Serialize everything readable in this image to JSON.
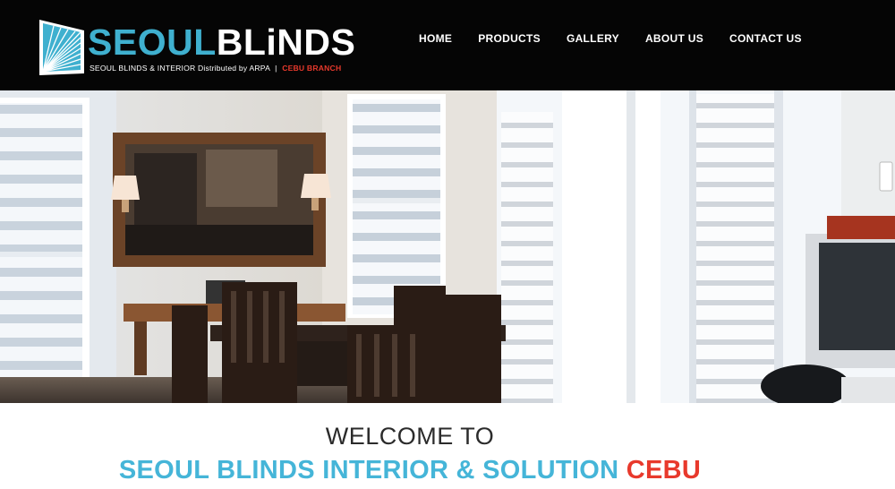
{
  "brand": {
    "name_part1": "SEOUL",
    "name_part2": "BLiNDS",
    "tagline": "SEOUL BLINDS & INTERIOR",
    "distributed": "Distributed by ARPA",
    "separator": "|",
    "branch": "CEBU BRANCH",
    "colors": {
      "blue": "#3fb0cf",
      "red": "#e8392c",
      "header_bg": "#050505"
    }
  },
  "nav": {
    "items": [
      {
        "label": "HOME"
      },
      {
        "label": "PRODUCTS"
      },
      {
        "label": "GALLERY"
      },
      {
        "label": "ABOUT US"
      },
      {
        "label": "CONTACT US"
      }
    ]
  },
  "hero": {
    "image_alt": "Dining room with window blinds and shutters"
  },
  "main": {
    "welcome": "WELCOME TO",
    "headline_part1": "SEOUL BLINDS INTERIOR & SOLUTION",
    "headline_part2": "CEBU"
  }
}
